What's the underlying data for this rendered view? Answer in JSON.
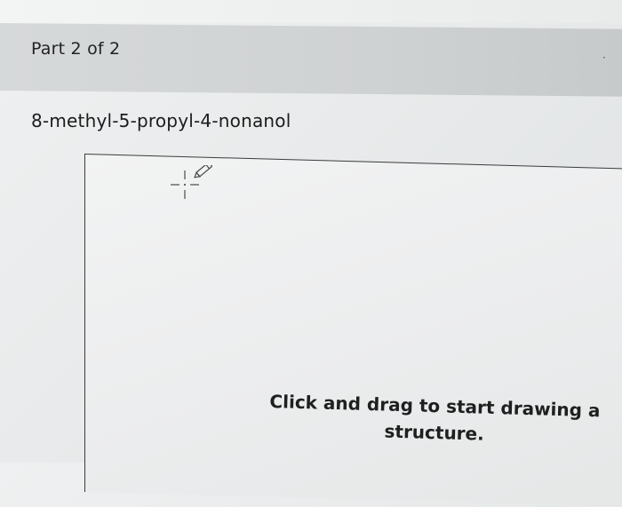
{
  "part": {
    "label": "Part 2 of 2"
  },
  "question": {
    "compound_name": "8-methyl-5-propyl-4-nonanol"
  },
  "canvas": {
    "cursor_icon": "crosshair-pencil-icon",
    "hint_line1": "Click and drag to start drawing a",
    "hint_line2": "structure."
  }
}
